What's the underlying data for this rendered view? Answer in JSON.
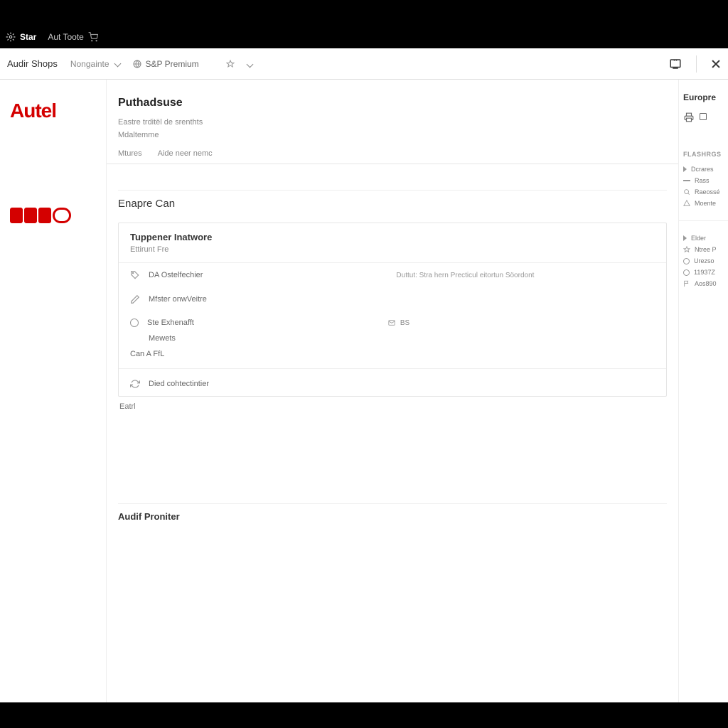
{
  "tabs": {
    "star": "Star",
    "tools": "Aut Toote"
  },
  "toolbar": {
    "crumb1": "Audir Shops",
    "crumb2": "Nongainte",
    "crumb3": "S&P Premium"
  },
  "logo": "Autel",
  "page": {
    "title": "Puthadsuse",
    "sub1": "Eastre trditёl de srenthts",
    "sub2": "Mdaltemme",
    "tab1": "Mtures",
    "tab2": "Aide neer nemc"
  },
  "section": {
    "heading": "Enapre Can",
    "card_header": "Tuppener Inatwore",
    "card_subhead": "Ettirunt Fre",
    "row1": "DA Ostelfechier",
    "row1_desc": "Duttut: Stra hern Precticul eitortun Söordont",
    "row2": "Mfster onwVeitre",
    "row3": "Ste Exhenafft",
    "row3_badge": "BS",
    "row3_sub": "Mewets",
    "row4": "Can A FfL",
    "row5": "Died cohtectintier",
    "footer": "Eatrl"
  },
  "bottom_section": "Audif Proniter",
  "rightpanel": {
    "title": "Europre",
    "section1_label": "FLASHRGS",
    "s1_items": [
      "Dcrares",
      "Rass",
      "Raeossé",
      "Moente"
    ],
    "s2_items": [
      "Elder",
      "Ntree P",
      "Urezso",
      "11937Z",
      "Aos890"
    ]
  },
  "colors": {
    "accent": "#d40000"
  }
}
